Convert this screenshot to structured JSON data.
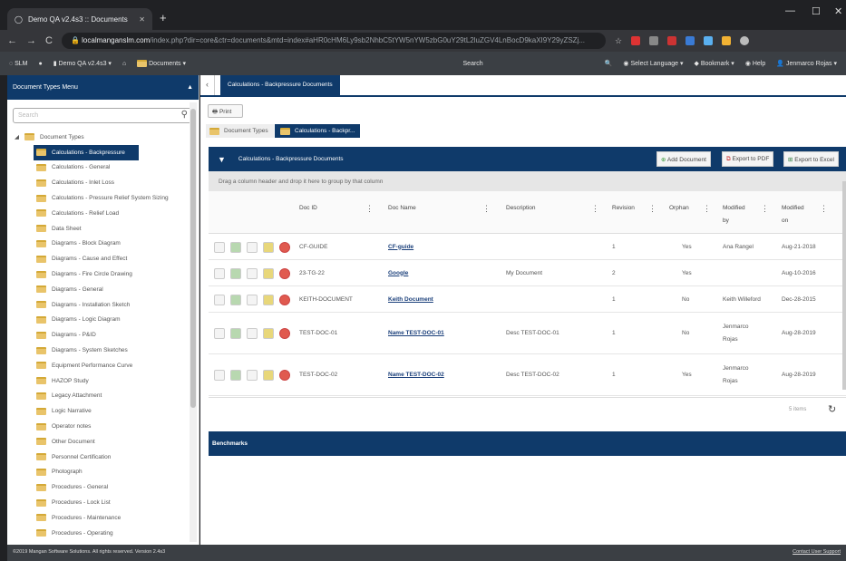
{
  "browser": {
    "tab_title": "Demo QA v2.4s3 :: Documents",
    "url_host": "localmanganslm.com",
    "url_path": "/index.php?dir=core&ctr=documents&mtd=index#aHR0cHM6Ly9sb2NhbC5tYW5nYW5zbG0uY29tL2luZGV4LnBocD9kaXI9Y29yZSZj..."
  },
  "nav": {
    "slm": "SLM",
    "project": "Demo QA v2.4s3",
    "section": "Documents",
    "search": "Search",
    "language": "Select Language",
    "bookmark": "Bookmark",
    "help": "Help",
    "user": "Jenmarco Rojas"
  },
  "sidebar": {
    "title": "Document Types Menu",
    "search_placeholder": "Search",
    "root": "Document Types",
    "items": [
      "Calculations - Backpressure",
      "Calculations - General",
      "Calculations - Inlet Loss",
      "Calculations - Pressure Relief System Sizing",
      "Calculations - Relief Load",
      "Data Sheet",
      "Diagrams - Block Diagram",
      "Diagrams - Cause and Effect",
      "Diagrams - Fire Circle Drawing",
      "Diagrams - General",
      "Diagrams - Installation Sketch",
      "Diagrams - Logic Diagram",
      "Diagrams - P&ID",
      "Diagrams - System Sketches",
      "Equipment Performance Curve",
      "HAZOP Study",
      "Legacy Attachment",
      "Logic Narrative",
      "Operator notes",
      "Other Document",
      "Personnel Certification",
      "Photograph",
      "Procedures - General",
      "Procedures - Lock List",
      "Procedures - Maintenance",
      "Procedures - Operating"
    ]
  },
  "main": {
    "tab": "Calculations - Backpressure Documents",
    "print": "Print",
    "crumb_root": "Document Types",
    "crumb_current": "Calculations - Backpr...",
    "grid_title": "Calculations - Backpressure Documents",
    "add": "Add Document",
    "pdf": "Export to PDF",
    "excel": "Export to Excel",
    "group_hint": "Drag a column header and drop it here to group by that column",
    "columns": {
      "docid": "Doc ID",
      "docname": "Doc Name",
      "desc": "Description",
      "rev": "Revision",
      "orphan": "Orphan",
      "modby1": "Modified",
      "modby2": "by",
      "modon1": "Modified",
      "modon2": "on"
    },
    "rows": [
      {
        "id": "CF-GUIDE",
        "name": "CF-guide",
        "desc": "",
        "rev": "1",
        "orphan": "Yes",
        "by1": "Ana Rangel",
        "by2": "",
        "on": "Aug-21-2018"
      },
      {
        "id": "23-TG-22",
        "name": "Google",
        "desc": "My Document",
        "rev": "2",
        "orphan": "Yes",
        "by1": "",
        "by2": "",
        "on": "Aug-10-2016"
      },
      {
        "id": "KEITH-DOCUMENT",
        "name": "Keith Document",
        "desc": "",
        "rev": "1",
        "orphan": "No",
        "by1": "Keith Willeford",
        "by2": "",
        "on": "Dec-28-2015"
      },
      {
        "id": "TEST-DOC-01",
        "name": "Name TEST-DOC-01",
        "desc": "Desc TEST-DOC-01",
        "rev": "1",
        "orphan": "No",
        "by1": "Jenmarco",
        "by2": "Rojas",
        "on": "Aug-28-2019"
      },
      {
        "id": "TEST-DOC-02",
        "name": "Name TEST-DOC-02",
        "desc": "Desc TEST-DOC-02",
        "rev": "1",
        "orphan": "Yes",
        "by1": "Jenmarco",
        "by2": "Rojas",
        "on": "Aug-28-2019"
      }
    ],
    "items_count": "5 items",
    "benchmarks": "Benchmarks"
  },
  "footer": {
    "left": "©2019 Mangan Software Solutions. All rights reserved. Version 2.4s3",
    "right": "Contact User Support"
  }
}
